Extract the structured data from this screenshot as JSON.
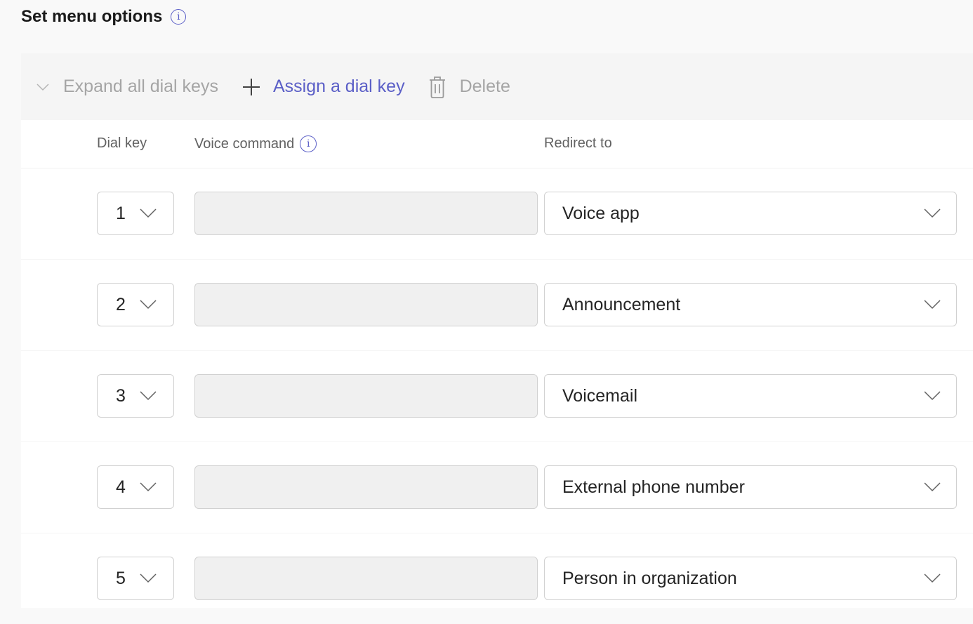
{
  "section": {
    "title": "Set menu options",
    "info_icon": "info-icon"
  },
  "toolbar": {
    "expand_label": "Expand all dial keys",
    "expand_icon": "chevron-down-icon",
    "assign_label": "Assign a dial key",
    "assign_icon": "plus-icon",
    "delete_label": "Delete",
    "delete_icon": "trash-icon",
    "accent_color": "#5b5fc7",
    "disabled_color": "#a5a5a5"
  },
  "table": {
    "columns": {
      "dial_key": "Dial key",
      "voice_command": "Voice command",
      "redirect_to": "Redirect to"
    },
    "rows": [
      {
        "dial_key": "1",
        "voice_command": "",
        "redirect_to": "Voice app"
      },
      {
        "dial_key": "2",
        "voice_command": "",
        "redirect_to": "Announcement"
      },
      {
        "dial_key": "3",
        "voice_command": "",
        "redirect_to": "Voicemail"
      },
      {
        "dial_key": "4",
        "voice_command": "",
        "redirect_to": "External phone number"
      },
      {
        "dial_key": "5",
        "voice_command": "",
        "redirect_to": "Person in organization"
      }
    ]
  }
}
